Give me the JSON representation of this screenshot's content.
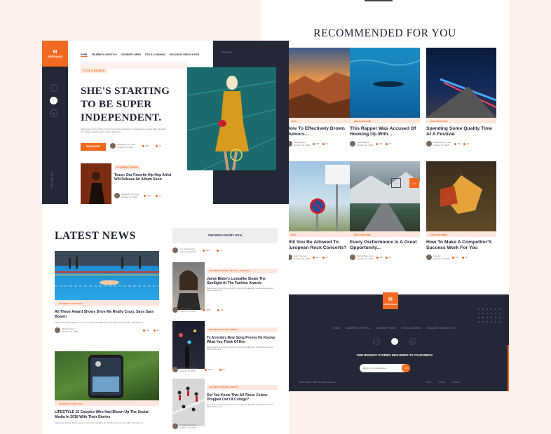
{
  "right": {
    "recommended_title": "RECOMMENDED FOR YOU",
    "cards": [
      {
        "tag": "TECH",
        "title": "How To Effectively Drown Rumors...",
        "author": "Jade Olukers",
        "date": "October 15, 2026",
        "views": "180",
        "comments": "26"
      },
      {
        "tag": "ENCOUNTERING",
        "title": "This Rapper Was Accused Of Hooking Up With...",
        "author": "Salil Mataimo",
        "date": "October 15, 2026",
        "views": "180",
        "comments": "26"
      },
      {
        "tag": "EXCLUSIVE PICS",
        "title": "Spending Some Quality Time At A Festival",
        "author": "Alexander M. Louis",
        "date": "October 15, 2026",
        "views": "180",
        "comments": "26"
      },
      {
        "tag": "PICS",
        "title": "Will You Be Allowed To European Rock Concerts?",
        "author": "Julia Freeman",
        "date": "October 15, 2026",
        "views": "180",
        "comments": "26"
      },
      {
        "tag": "ENCOUNTERING",
        "title": "Every Performance Is A Great Opportunity...",
        "author": "Patrick Beaumont",
        "date": "October 15, 2026",
        "views": "180",
        "comments": "26"
      },
      {
        "tag": "ENCOUNTERING",
        "title": "How To Make A Competitor'S Success Work For You",
        "author": "Claudia",
        "date": "October 15, 2026",
        "views": "180",
        "comments": "26"
      }
    ]
  },
  "footer": {
    "logo": "ENTER MAGS",
    "nav": [
      "Home",
      "Celebrity Lifestyle",
      "Celebrity News",
      "Style & Fashion",
      "Exclusive Videos & Pics"
    ],
    "subscribe": "OUR BIGGEST STORIES DELIVERED TO YOUR INBOX",
    "email_placeholder": "Enter your email address",
    "go": "GO",
    "copyright": "Enter Mags © 2026. All rights reserved.",
    "links": [
      "Terms",
      "Privacy",
      "Support"
    ]
  },
  "header": {
    "logo": "ENTER MAGS",
    "nav": [
      "HOME",
      "CELEBRITY LIFESTYLE",
      "CELEBRITY NEWS",
      "STYLE & FASHION",
      "EXCLUSIVE VIDEOS & PICS"
    ],
    "search": "SEARCH...",
    "follow": "FOLLOW US"
  },
  "hero": {
    "tag": "STYLE & FASHION",
    "headline": "SHE'S STARTING TO BE SUPER INDEPENDENT.",
    "desc": "Maecenas At Arcu Risus. Donec Commodo Sodales Ex, Scelerisque Laoreet Nibh Hendrerit Id. In Aliquet Magna Nec Lobortis Maximus.",
    "button": "READ MORE",
    "author": "Alexander M. Louis",
    "date": "October 15, 2026",
    "views": "180",
    "comments": "26",
    "mini": {
      "tag": "CELEBRITY NEWS",
      "title": "Tease: Our Favorite Hip Hop Artist Will Release An Album Soon",
      "author": "Alexander M. Louis",
      "date": "October 15, 2026",
      "views": "1050",
      "comments": "26"
    }
  },
  "latest": {
    "title": "LATEST  NEWS",
    "items": [
      {
        "tag": "CELEBRITY LIFESTYLE",
        "title": "All These Award Shows Drive Me Really Crazy, Says Sara Bowen",
        "desc": "Maecenas At Arcu Risus. Donec Commodo Sodales Ex, Scelerisque Laoreet Nibh Hendrerit Id.",
        "author": "Michael Stein",
        "date": "October 15, 2026",
        "views": "180",
        "comments": "26"
      },
      {
        "tag": "CELEBRITY LIFESTYLE",
        "title": "LIFESTYLE 10 Couples Who Had Blown Up The Social Media In 2018 With Their Stories",
        "desc": "Maecenas At Arcu Risus. Donec Commodo Sodales Ex, Scelerisque Laoreet Nibh Hendrerit Id."
      }
    ]
  },
  "trending": {
    "title": "TRENDING RIGHT NOW",
    "top_author": "Ayo Ogunseinde",
    "top_date": "October 15, 2026",
    "top_views": "180",
    "top_comments": "26",
    "items": [
      {
        "tag": "CELEBRITY NEWS, STYLE & FASHION",
        "title": "Jamie Blake's Lookalike Steals The Spotlight At The Fashion Awards",
        "desc": "Maecenas At Arcu Risus. Donec Commodo Sodales Ex, Scelerisque Laoreet Nibh Hendrerit Id.",
        "author": "Jasmin Hale",
        "date": "October 15, 2026",
        "views": "1050",
        "comments": "26"
      },
      {
        "tag": "CELEBRITY NEWS, VIDEOS",
        "title": "Ty Arreola's New Song Proves He Knows What You Think Of Him",
        "desc": "Maecenas At Arcu Risus. Donec Commodo Sodales Ex, Scelerisque Laoreet Nibh Hendrerit Id.",
        "author": "Alexander M. Louis",
        "date": "October 15, 2026",
        "views": "1050",
        "comments": "26"
      },
      {
        "tag": "CELEBRITY NEWS, VIDEOS",
        "title": "Did You Know That All These Celebs Dropped Out Of College?",
        "desc": "Maecenas At Arcu Risus. Donec Commodo Sodales Ex, Scelerisque Laoreet Nibh Hendrerit Id.",
        "author": "Christian Buehner",
        "date": "October 15, 2026"
      }
    ]
  }
}
